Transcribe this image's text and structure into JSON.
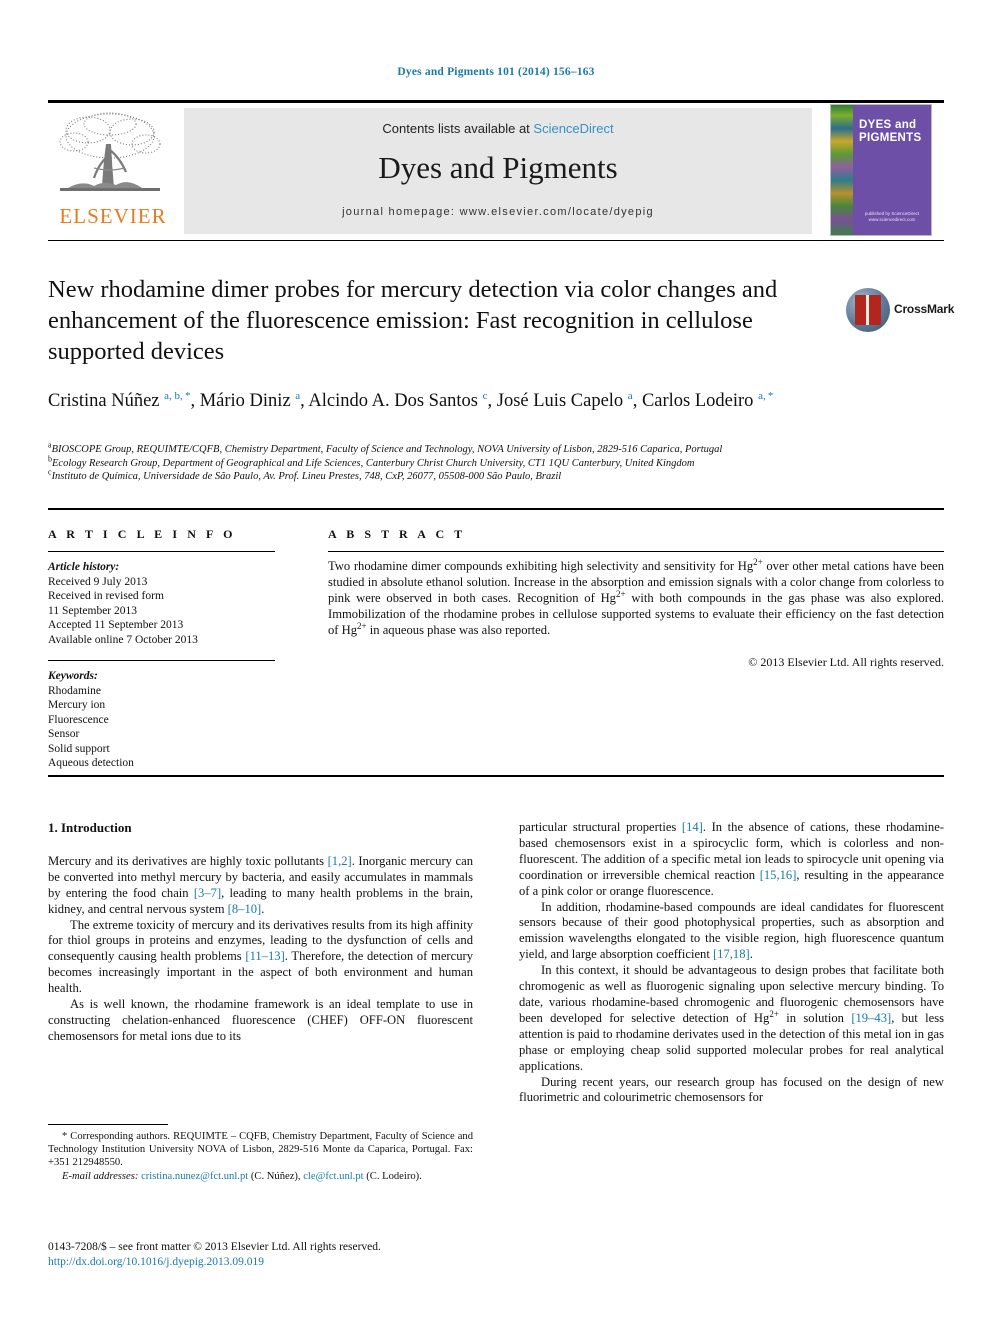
{
  "running_head": "Dyes and Pigments 101 (2014) 156–163",
  "masthead": {
    "contents_prefix": "Contents lists available at ",
    "sciencedirect": "ScienceDirect",
    "journal_title": "Dyes and Pigments",
    "homepage": "journal homepage: www.elsevier.com/locate/dyepig",
    "publisher_name": "ELSEVIER",
    "cover_title": "DYES and PIGMENTS",
    "cover_footer": "published by\nScienceDirect\nwww.sciencedirect.com",
    "accent_blue": "#1a7aa8",
    "elsevier_orange": "#e87b1e",
    "cover_purple": "#6d4fa8"
  },
  "article": {
    "title": "New rhodamine dimer probes for mercury detection via color changes and enhancement of the fluorescence emission: Fast recognition in cellulose supported devices",
    "crossmark_label": "CrossMark",
    "authors_html": "Cristina Núñez <sup>a, b, *</sup>, Mário Diniz <sup>a</sup>, Alcindo A. Dos Santos <sup>c</sup>, José Luis Capelo <sup>a</sup>, Carlos Lodeiro <sup>a, *</sup>",
    "affiliations": [
      "BIOSCOPE Group, REQUIMTE/CQFB, Chemistry Department, Faculty of Science and Technology, NOVA University of Lisbon, 2829-516 Caparica, Portugal",
      "Ecology Research Group, Department of Geographical and Life Sciences, Canterbury Christ Church University, CT1 1QU Canterbury, United Kingdom",
      "Instituto de Química, Universidade de São Paulo, Av. Prof. Lineu Prestes, 748, CxP, 26077, 05508-000 São Paulo, Brazil"
    ],
    "affiliation_marks": [
      "a",
      "b",
      "c"
    ]
  },
  "article_info": {
    "heading": "A R T I C L E   I N F O",
    "history_label": "Article history:",
    "history": [
      "Received 9 July 2013",
      "Received in revised form",
      "11 September 2013",
      "Accepted 11 September 2013",
      "Available online 7 October 2013"
    ],
    "keywords_label": "Keywords:",
    "keywords": [
      "Rhodamine",
      "Mercury ion",
      "Fluorescence",
      "Sensor",
      "Solid support",
      "Aqueous detection"
    ]
  },
  "abstract": {
    "heading": "A B S T R A C T",
    "body_html": "Two rhodamine dimer compounds exhibiting high selectivity and sensitivity for Hg<sup>2+</sup> over other metal cations have been studied in absolute ethanol solution. Increase in the absorption and emission signals with a color change from colorless to pink were observed in both cases. Recognition of Hg<sup>2+</sup> with both compounds in the gas phase was also explored. Immobilization of the rhodamine probes in cellulose supported systems to evaluate their efficiency on the fast detection of Hg<sup>2+</sup> in aqueous phase was also reported.",
    "copyright": "© 2013 Elsevier Ltd. All rights reserved."
  },
  "body": {
    "section_number_title": "1. Introduction",
    "left_paragraphs_html": [
      "Mercury and its derivatives are highly toxic pollutants <span class=\"cite\">[1,2]</span>. Inorganic mercury can be converted into methyl mercury by bacteria, and easily accumulates in mammals by entering the food chain <span class=\"cite\">[3–7]</span>, leading to many health problems in the brain, kidney, and central nervous system <span class=\"cite\">[8–10]</span>.",
      "The extreme toxicity of mercury and its derivatives results from its high affinity for thiol groups in proteins and enzymes, leading to the dysfunction of cells and consequently causing health problems <span class=\"cite\">[11–13]</span>. Therefore, the detection of mercury becomes increasingly important in the aspect of both environment and human health.",
      "As is well known, the rhodamine framework is an ideal template to use in constructing chelation-enhanced fluorescence (CHEF) OFF-ON fluorescent chemosensors for metal ions due to its"
    ],
    "right_paragraphs_html": [
      "particular structural properties <span class=\"cite\">[14]</span>. In the absence of cations, these rhodamine-based chemosensors exist in a spirocyclic form, which is colorless and non-fluorescent. The addition of a specific metal ion leads to spirocycle unit opening via coordination or irreversible chemical reaction <span class=\"cite\">[15,16]</span>, resulting in the appearance of a pink color or orange fluorescence.",
      "In addition, rhodamine-based compounds are ideal candidates for fluorescent sensors because of their good photophysical properties, such as absorption and emission wavelengths elongated to the visible region, high fluorescence quantum yield, and large absorption coefficient <span class=\"cite\">[17,18]</span>.",
      "In this context, it should be advantageous to design probes that facilitate both chromogenic as well as fluorogenic signaling upon selective mercury binding. To date, various rhodamine-based chromogenic and fluorogenic chemosensors have been developed for selective detection of Hg<sup>2+</sup> in solution <span class=\"cite\">[19–43]</span>, but less attention is paid to rhodamine derivates used in the detection of this metal ion in gas phase or employing cheap solid supported molecular probes for real analytical applications.",
      "During recent years, our research group has focused on the design of new fluorimetric and colourimetric chemosensors for"
    ]
  },
  "footnote": {
    "corresponding_html": "<span class=\"star\">*</span> Corresponding authors. REQUIMTE – CQFB, Chemistry Department, Faculty of Science and Technology Institution University NOVA of Lisbon, 2829-516 Monte da Caparica, Portugal. Fax: +351 212948550.",
    "emails_html": "<span class=\"em-lbl\">E-mail addresses:</span> <span class=\"link\">cristina.nunez@fct.unl.pt</span> (C. Núñez), <span class=\"link\">cle@fct.unl.pt</span> (C. Lodeiro)."
  },
  "page_footer": {
    "issn_line": "0143-7208/$ – see front matter © 2013 Elsevier Ltd. All rights reserved.",
    "doi": "http://dx.doi.org/10.1016/j.dyepig.2013.09.019"
  }
}
